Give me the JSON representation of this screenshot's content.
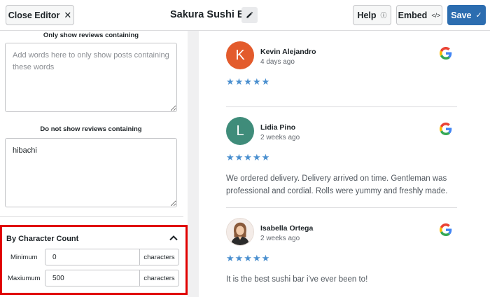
{
  "header": {
    "close_label": "Close Editor",
    "title": "Sakura Sushi Bar",
    "help_label": "Help",
    "embed_label": "Embed",
    "save_label": "Save"
  },
  "filters": {
    "include": {
      "label": "Only show reviews containing",
      "placeholder": "Add words here to only show posts containing these words",
      "value": ""
    },
    "exclude": {
      "label": "Do not show reviews containing",
      "value": "hibachi"
    }
  },
  "char_count": {
    "title": "By Character Count",
    "min_label": "Minimum",
    "min_value": "0",
    "max_label": "Maxiumum",
    "max_value": "500",
    "unit": "characters"
  },
  "reviews": [
    {
      "initial": "K",
      "name": "Kevin Alejandro",
      "time": "4 days ago",
      "stars": "★★★★★",
      "text": "",
      "color": "#e35b2c"
    },
    {
      "initial": "L",
      "name": "Lidia Pino",
      "time": "2 weeks ago",
      "stars": "★★★★★",
      "text": "We ordered delivery. Delivery arrived on time. Gentleman was professional and cordial. Rolls were yummy and freshly made.",
      "color": "#3f8c7a"
    },
    {
      "initial": "",
      "name": "Isabella Ortega",
      "time": "2 weeks ago",
      "stars": "★★★★★",
      "text": "It is the best sushi bar i've ever been to!",
      "color": "#f2d8cf"
    }
  ],
  "colors": {
    "accent": "#2c6db0",
    "highlight": "#e00000",
    "star": "#4a8fcf"
  },
  "icons": {
    "close": "close-icon",
    "edit": "pencil-icon",
    "help": "help-icon",
    "embed": "code-icon",
    "save": "check-icon",
    "collapse": "chevron-up-icon",
    "source": "google-icon"
  }
}
